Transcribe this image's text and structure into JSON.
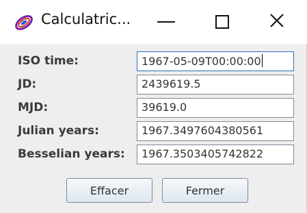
{
  "window": {
    "title": "Calculatric...",
    "icon": "galaxy-icon",
    "controls": {
      "minimize": "minimize-icon",
      "maximize": "maximize-icon",
      "close_glyph": "✕"
    }
  },
  "form": {
    "rows": [
      {
        "label": "ISO time:",
        "value": "1967-05-09T00:00:00"
      },
      {
        "label": "JD:",
        "value": "2439619.5"
      },
      {
        "label": "MJD:",
        "value": "39619.0"
      },
      {
        "label": "Julian years:",
        "value": "1967.3497604380561"
      },
      {
        "label": "Besselian years:",
        "value": "1967.3503405742822"
      }
    ]
  },
  "buttons": {
    "clear_label": "Effacer",
    "close_label": "Fermer"
  }
}
